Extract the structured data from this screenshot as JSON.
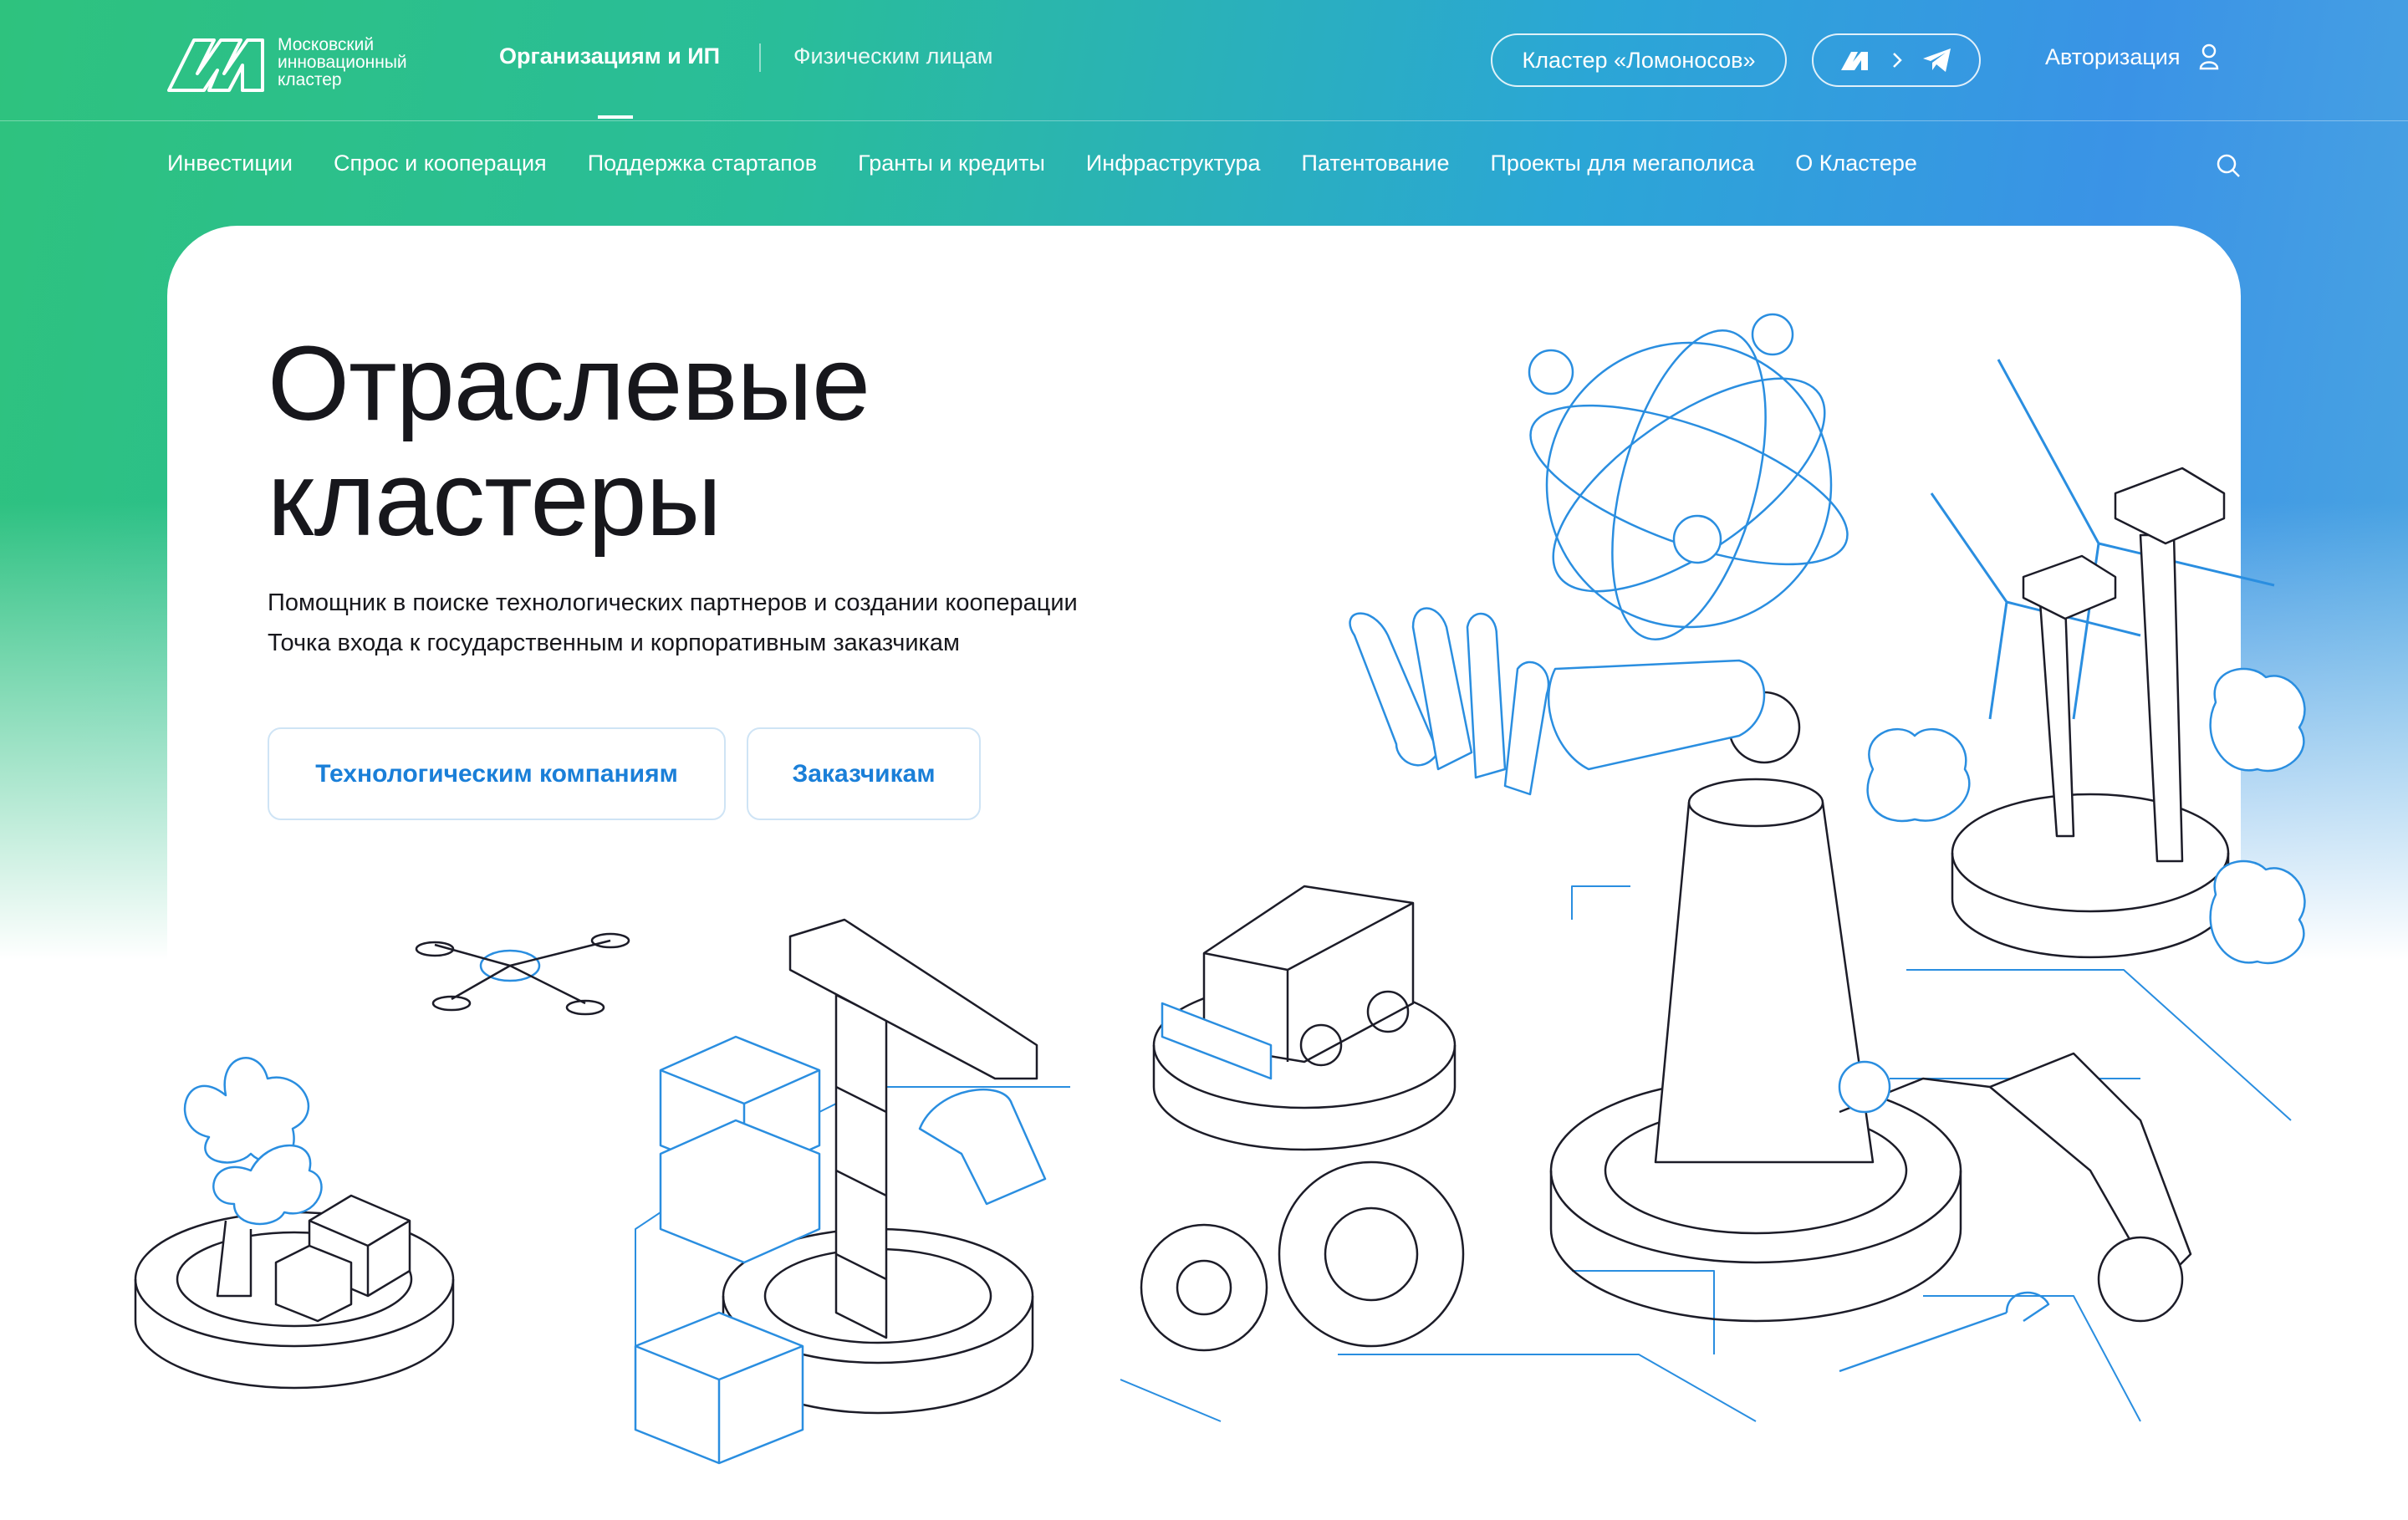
{
  "header": {
    "logo_text_lines": [
      "Московский",
      "инновационный",
      "кластер"
    ],
    "segments": [
      {
        "label": "Организациям и ИП",
        "active": true
      },
      {
        "label": "Физическим лицам",
        "active": false
      }
    ],
    "cluster_pill": "Кластер «Ломоносов»",
    "social_icons": [
      "max-icon",
      "chevron-right-icon",
      "telegram-icon"
    ],
    "auth_label": "Авторизация"
  },
  "nav": {
    "items": [
      "Инвестиции",
      "Спрос и кооперация",
      "Поддержка стартапов",
      "Гранты и кредиты",
      "Инфраструктура",
      "Патентование",
      "Проекты для мегаполиса",
      "О Кластере"
    ]
  },
  "hero": {
    "title_lines": [
      "Отраслевые",
      "кластеры"
    ],
    "subtitle_lines": [
      "Помощник в поиске технологических партнеров и создании кооперации",
      "Точка входа к государственным и корпоративным заказчикам"
    ],
    "buttons": [
      "Технологическим компаниям",
      "Заказчикам"
    ]
  },
  "colors": {
    "accent": "#1a7fd8",
    "header_gradient_start": "#2ec27e",
    "header_gradient_end": "#3a93e6",
    "text_dark": "#17171c"
  }
}
